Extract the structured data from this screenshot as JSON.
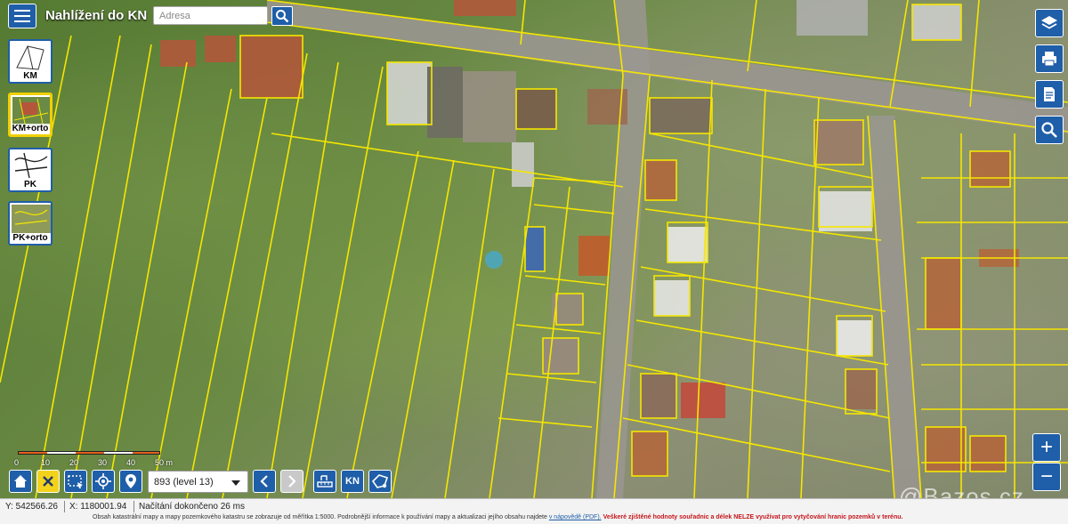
{
  "app": {
    "title": "Nahlížení do KN"
  },
  "search": {
    "placeholder": "Adresa"
  },
  "layers": [
    {
      "label": "KM"
    },
    {
      "label": "KM+orto"
    },
    {
      "label": "PK"
    },
    {
      "label": "PK+orto"
    }
  ],
  "scale": {
    "labels": [
      "0",
      "10",
      "20",
      "30",
      "40",
      "50 m"
    ]
  },
  "toolbar": {
    "level_value": "893 (level 13)",
    "km_label": "KN"
  },
  "status": {
    "y_coord": "Y: 542566.26",
    "x_coord": "X: 1180001.94",
    "load_text": "Načítání dokončeno 26 ms",
    "disclaimer_text": "Obsah katastrální mapy a mapy pozemkového katastru se zobrazuje od měřítka 1:5000. Podrobnější informace k používání mapy a aktualizaci jejího obsahu najdete",
    "disclaimer_link": "v nápovědě (PDF).",
    "disclaimer_warning": "Veškeré zjištěné hodnoty souřadnic a délek NELZE využívat pro vytyčování hranic pozemků v terénu."
  },
  "watermark": "@Bazos.cz",
  "colors": {
    "primary": "#1f5ea8",
    "parcel_lines": "#f5e600",
    "active_layer_border": "#f0d000",
    "warning": "#c4161c"
  },
  "icons": {
    "menu": "hamburger-icon",
    "search": "search-icon",
    "layers": "layers-icon",
    "print": "printer-icon",
    "report": "document-icon",
    "magnify": "magnifier-icon",
    "home": "home-icon",
    "select": "x-select-icon",
    "rect_select": "rectangle-select-icon",
    "locate": "crosshair-icon",
    "pin": "map-pin-icon",
    "back": "chevron-left-icon",
    "forward": "chevron-right-icon",
    "measure": "measure-icon",
    "polygon": "polygon-icon",
    "zoom_in": "plus-icon",
    "zoom_out": "minus-icon"
  }
}
